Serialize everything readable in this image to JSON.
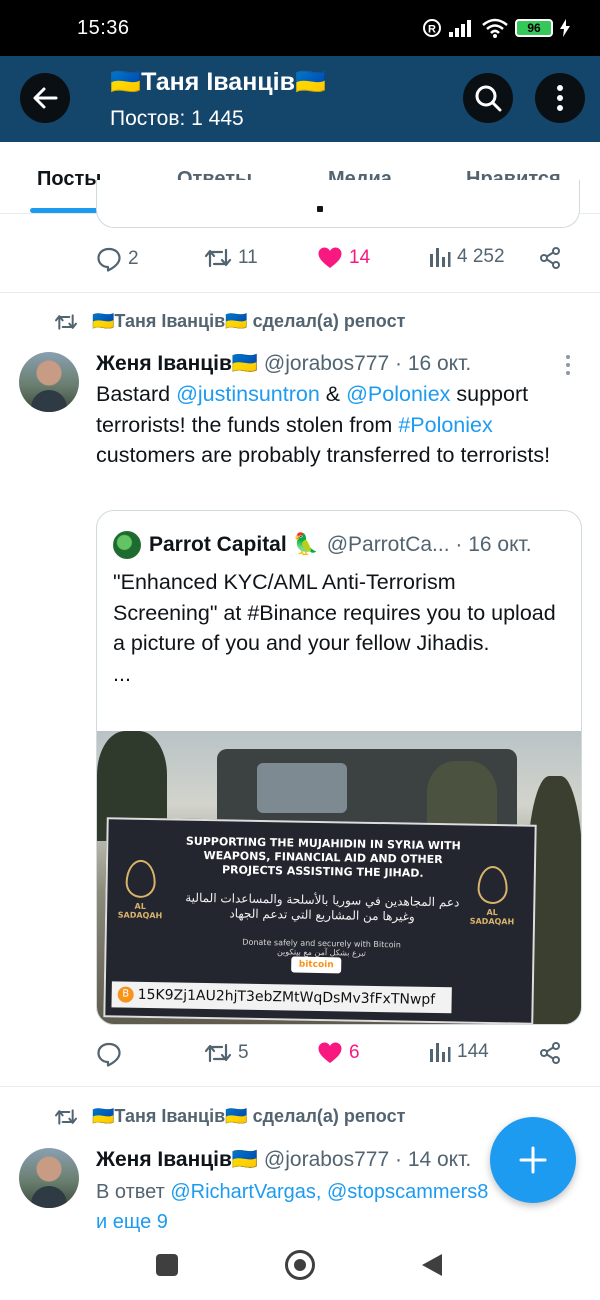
{
  "status_bar": {
    "time": "15:36",
    "battery": "96",
    "icons": [
      "r-circle-icon",
      "signal-icon",
      "wifi-icon",
      "battery-icon",
      "charging-icon"
    ]
  },
  "header": {
    "title": "🇺🇦Таня Іванців🇺🇦",
    "subtitle": "Постов: 1 445",
    "back_icon": "arrow-left-icon",
    "search_icon": "search-icon",
    "more_icon": "more-vertical-icon",
    "background": "#14456b"
  },
  "tabs": [
    {
      "label": "Посты",
      "active": true
    },
    {
      "label": "Ответы",
      "active": false
    },
    {
      "label": "Медиа",
      "active": false
    },
    {
      "label": "Нравится",
      "active": false
    }
  ],
  "post1_actions": {
    "replies": "2",
    "reposts": "11",
    "likes": "14",
    "views": "4 252"
  },
  "post2": {
    "repost_label": "🇺🇦Таня Іванців🇺🇦 сделал(а) репост",
    "author_name": "Женя Іванців🇺🇦",
    "handle_date": "@jorabos777 · 16 окт.",
    "text": {
      "t1": "Bastard ",
      "m1": "@justinsuntron",
      "t2": " & ",
      "m2": "@Poloniex",
      "t3": " support terrorists! the funds stolen from ",
      "h1": "#Poloniex",
      "t4": " customers are probably transferred to terrorists!"
    },
    "quote": {
      "name": "Parrot Capital 🦜",
      "handle_date": "@ParrotCa... · 16 окт.",
      "text": "\"Enhanced KYC/AML Anti-Terrorism Screening\" at #Binance requires you to upload a picture of you and your fellow Jihadis.",
      "ellipsis": "...",
      "image_banner": {
        "headline": "SUPPORTING THE MUJAHIDIN IN SYRIA WITH WEAPONS, FINANCIAL AID AND OTHER PROJECTS ASSISTING THE JIHAD.",
        "arabic": "دعم المجاهدين في سوريا بالأسلحة والمساعدات المالية وغيرها من المشاريع التي تدعم الجهاد",
        "donate": "Donate safely and securely with Bitcoin",
        "donate_ar": "تبرع بشكل آمن مع بيتكوين",
        "bitcoin_badge": "bitcoin",
        "logo_text": "AL SADAQAH",
        "address": "15K9Zj1AU2hjT3ebZMtWqDsMv3fFxTNwpf"
      }
    },
    "actions": {
      "replies": "",
      "reposts": "5",
      "likes": "6",
      "views": "144"
    }
  },
  "post3": {
    "repost_label": "🇺🇦Таня Іванців🇺🇦 сделал(а) репост",
    "author_name": "Женя Іванців🇺🇦",
    "handle_date": "@jorabos777 · 14 окт.",
    "reply_prefix": "В ответ ",
    "reply_to": "@RichartVargas, @stopscammers8",
    "reply_more": "и еще 9"
  },
  "colors": {
    "accent": "#1d9bf0",
    "like": "#f91880",
    "secondary_text": "#536471"
  }
}
